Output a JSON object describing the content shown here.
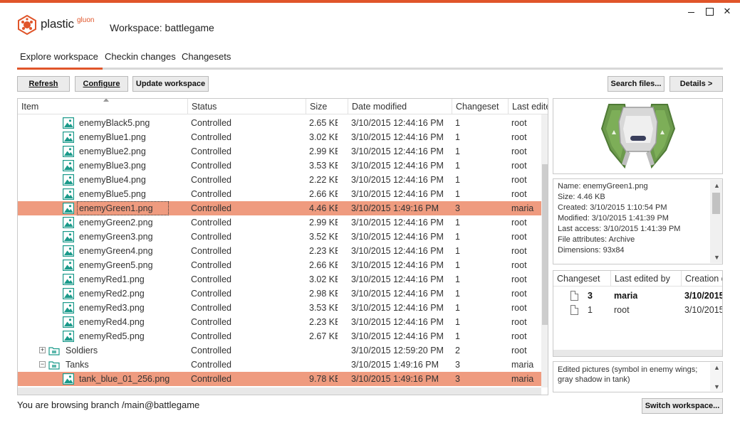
{
  "window": {
    "brand_name": "plastic",
    "brand_sub": "gluon",
    "title": "Workspace: battlegame",
    "accent": "#e0552a"
  },
  "tabs": [
    {
      "label": "Explore workspace",
      "active": true
    },
    {
      "label": "Checkin changes",
      "active": false
    },
    {
      "label": "Changesets",
      "active": false
    }
  ],
  "toolbar": {
    "refresh": "Refresh",
    "configure": "Configure",
    "update": "Update workspace",
    "search": "Search files...",
    "details": "Details >"
  },
  "grid": {
    "columns": [
      "Item",
      "Status",
      "Size",
      "Date modified",
      "Changeset",
      "Last edited by"
    ],
    "rows": [
      {
        "name": "enemyBlack5.png",
        "status": "Controlled",
        "size": "2.65 KB",
        "date": "3/10/2015 12:44:16 PM",
        "cs": "1",
        "last": "root",
        "type": "image"
      },
      {
        "name": "enemyBlue1.png",
        "status": "Controlled",
        "size": "3.02 KB",
        "date": "3/10/2015 12:44:16 PM",
        "cs": "1",
        "last": "root",
        "type": "image"
      },
      {
        "name": "enemyBlue2.png",
        "status": "Controlled",
        "size": "2.99 KB",
        "date": "3/10/2015 12:44:16 PM",
        "cs": "1",
        "last": "root",
        "type": "image"
      },
      {
        "name": "enemyBlue3.png",
        "status": "Controlled",
        "size": "3.53 KB",
        "date": "3/10/2015 12:44:16 PM",
        "cs": "1",
        "last": "root",
        "type": "image"
      },
      {
        "name": "enemyBlue4.png",
        "status": "Controlled",
        "size": "2.22 KB",
        "date": "3/10/2015 12:44:16 PM",
        "cs": "1",
        "last": "root",
        "type": "image"
      },
      {
        "name": "enemyBlue5.png",
        "status": "Controlled",
        "size": "2.66 KB",
        "date": "3/10/2015 12:44:16 PM",
        "cs": "1",
        "last": "root",
        "type": "image"
      },
      {
        "name": "enemyGreen1.png",
        "status": "Controlled",
        "size": "4.46 KB",
        "date": "3/10/2015 1:49:16 PM",
        "cs": "3",
        "last": "maria",
        "type": "image",
        "selected": true
      },
      {
        "name": "enemyGreen2.png",
        "status": "Controlled",
        "size": "2.99 KB",
        "date": "3/10/2015 12:44:16 PM",
        "cs": "1",
        "last": "root",
        "type": "image"
      },
      {
        "name": "enemyGreen3.png",
        "status": "Controlled",
        "size": "3.52 KB",
        "date": "3/10/2015 12:44:16 PM",
        "cs": "1",
        "last": "root",
        "type": "image"
      },
      {
        "name": "enemyGreen4.png",
        "status": "Controlled",
        "size": "2.23 KB",
        "date": "3/10/2015 12:44:16 PM",
        "cs": "1",
        "last": "root",
        "type": "image"
      },
      {
        "name": "enemyGreen5.png",
        "status": "Controlled",
        "size": "2.66 KB",
        "date": "3/10/2015 12:44:16 PM",
        "cs": "1",
        "last": "root",
        "type": "image"
      },
      {
        "name": "enemyRed1.png",
        "status": "Controlled",
        "size": "3.02 KB",
        "date": "3/10/2015 12:44:16 PM",
        "cs": "1",
        "last": "root",
        "type": "image"
      },
      {
        "name": "enemyRed2.png",
        "status": "Controlled",
        "size": "2.98 KB",
        "date": "3/10/2015 12:44:16 PM",
        "cs": "1",
        "last": "root",
        "type": "image"
      },
      {
        "name": "enemyRed3.png",
        "status": "Controlled",
        "size": "3.53 KB",
        "date": "3/10/2015 12:44:16 PM",
        "cs": "1",
        "last": "root",
        "type": "image"
      },
      {
        "name": "enemyRed4.png",
        "status": "Controlled",
        "size": "2.23 KB",
        "date": "3/10/2015 12:44:16 PM",
        "cs": "1",
        "last": "root",
        "type": "image"
      },
      {
        "name": "enemyRed5.png",
        "status": "Controlled",
        "size": "2.67 KB",
        "date": "3/10/2015 12:44:16 PM",
        "cs": "1",
        "last": "root",
        "type": "image"
      },
      {
        "name": "Soldiers",
        "status": "Controlled",
        "size": "",
        "date": "3/10/2015 12:59:20 PM",
        "cs": "2",
        "last": "root",
        "type": "folder",
        "expander": "+"
      },
      {
        "name": "Tanks",
        "status": "Controlled",
        "size": "",
        "date": "3/10/2015 1:49:16 PM",
        "cs": "3",
        "last": "maria",
        "type": "folder",
        "expander": "−"
      },
      {
        "name": "tank_blue_01_256.png",
        "status": "Controlled",
        "size": "9.78 KB",
        "date": "3/10/2015 1:49:16 PM",
        "cs": "3",
        "last": "maria",
        "type": "image",
        "highlight": true
      }
    ]
  },
  "properties": [
    "Name: enemyGreen1.png",
    "Size: 4.46 KB",
    "Created: 3/10/2015 1:10:54 PM",
    "Modified: 3/10/2015 1:41:39 PM",
    "Last access: 3/10/2015 1:41:39 PM",
    "File attributes: Archive",
    "Dimensions: 93x84"
  ],
  "history": {
    "columns": [
      "Changeset",
      "Last edited by",
      "Creation date"
    ],
    "rows": [
      {
        "cs": "3",
        "by": "maria",
        "date": "3/10/2015",
        "bold": true
      },
      {
        "cs": "1",
        "by": "root",
        "date": "3/10/2015",
        "bold": false
      }
    ]
  },
  "comment": "Edited pictures (symbol in enemy wings; gray shadow in tank)",
  "switch_button": "Switch workspace...",
  "status": "You are browsing branch /main@battlegame",
  "colors": {
    "selected_row": "#ef9b7f",
    "icon_teal": "#1a9a8a"
  }
}
